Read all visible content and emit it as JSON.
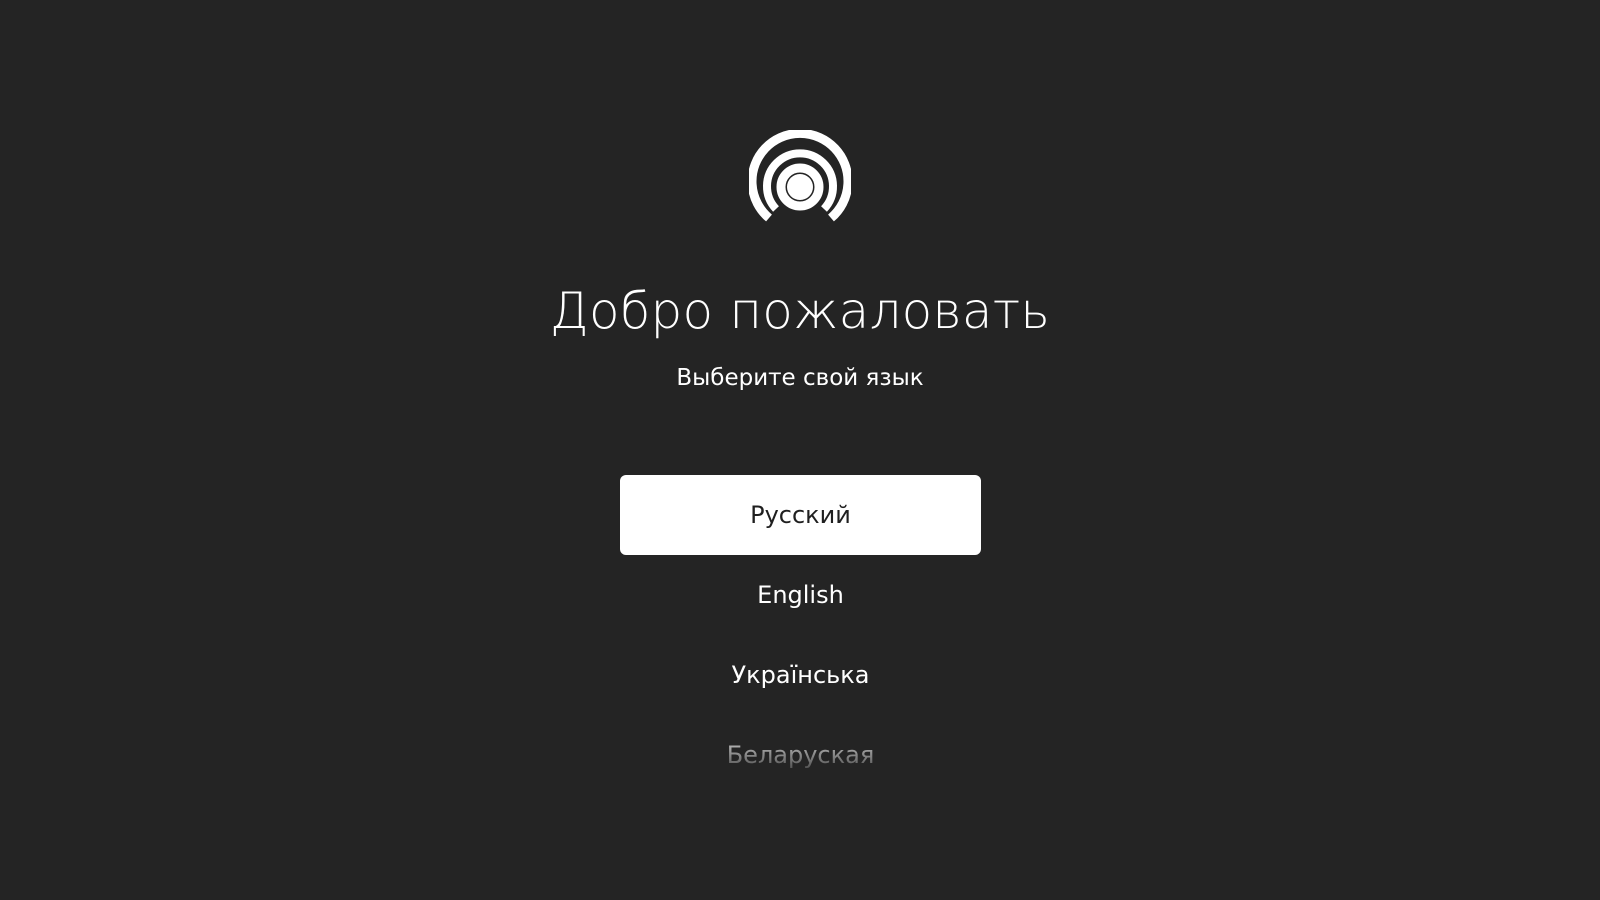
{
  "welcome": {
    "title": "Добро пожаловать",
    "subtitle": "Выберите свой язык"
  },
  "languages": {
    "selected_index": 0,
    "items": [
      {
        "label": "Русский",
        "selected": true
      },
      {
        "label": "English",
        "selected": false
      },
      {
        "label": "Українська",
        "selected": false
      },
      {
        "label": "Беларуская",
        "selected": false
      }
    ]
  },
  "logo": {
    "icon": "concentric-circles-logo-icon",
    "color": "#ffffff"
  },
  "colors": {
    "background": "#242424",
    "selected_background": "#ffffff",
    "selected_text": "#1f1f1f",
    "text": "#ffffff"
  }
}
